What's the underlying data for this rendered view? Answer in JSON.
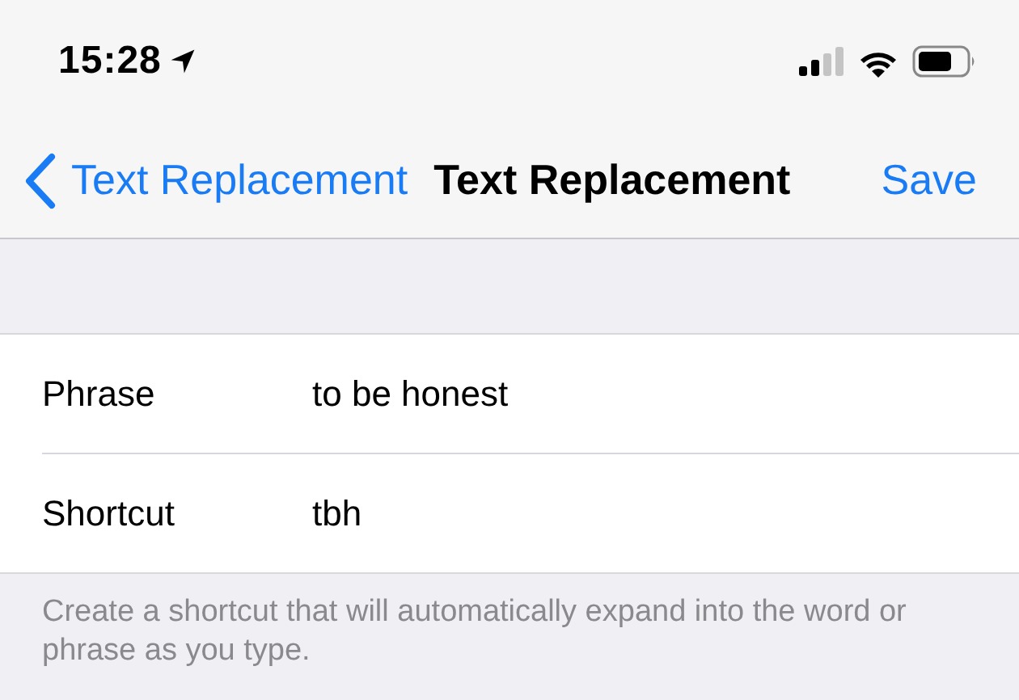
{
  "status_bar": {
    "time": "15:28"
  },
  "nav": {
    "back": "Text Replacement",
    "title": "Text Replacement",
    "action": "Save"
  },
  "fields": [
    {
      "label": "Phrase",
      "value": "to be honest"
    },
    {
      "label": "Shortcut",
      "value": "tbh"
    }
  ],
  "footer": "Create a shortcut that will automatically expand into the word or phrase as you type."
}
